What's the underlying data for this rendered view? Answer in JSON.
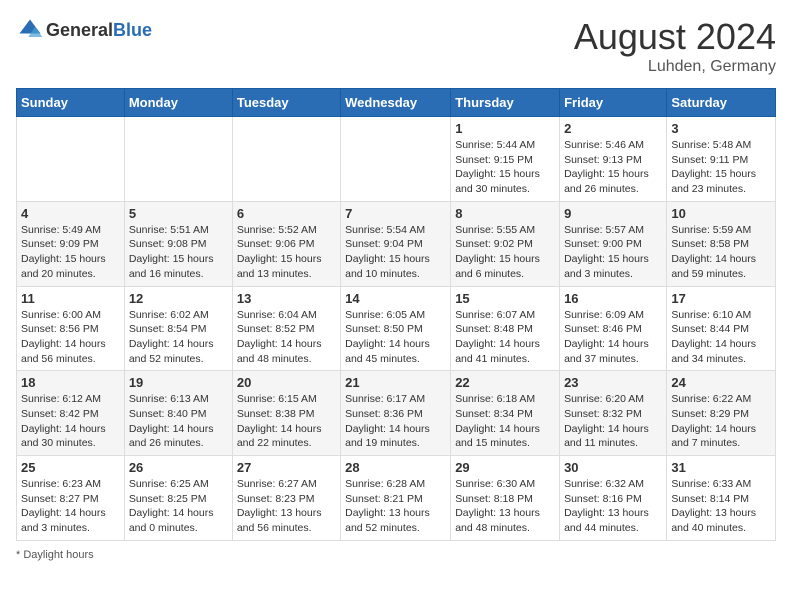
{
  "header": {
    "logo_general": "General",
    "logo_blue": "Blue",
    "month_year": "August 2024",
    "location": "Luhden, Germany"
  },
  "days_of_week": [
    "Sunday",
    "Monday",
    "Tuesday",
    "Wednesday",
    "Thursday",
    "Friday",
    "Saturday"
  ],
  "weeks": [
    [
      {
        "day": "",
        "info": ""
      },
      {
        "day": "",
        "info": ""
      },
      {
        "day": "",
        "info": ""
      },
      {
        "day": "",
        "info": ""
      },
      {
        "day": "1",
        "info": "Sunrise: 5:44 AM\nSunset: 9:15 PM\nDaylight: 15 hours\nand 30 minutes."
      },
      {
        "day": "2",
        "info": "Sunrise: 5:46 AM\nSunset: 9:13 PM\nDaylight: 15 hours\nand 26 minutes."
      },
      {
        "day": "3",
        "info": "Sunrise: 5:48 AM\nSunset: 9:11 PM\nDaylight: 15 hours\nand 23 minutes."
      }
    ],
    [
      {
        "day": "4",
        "info": "Sunrise: 5:49 AM\nSunset: 9:09 PM\nDaylight: 15 hours\nand 20 minutes."
      },
      {
        "day": "5",
        "info": "Sunrise: 5:51 AM\nSunset: 9:08 PM\nDaylight: 15 hours\nand 16 minutes."
      },
      {
        "day": "6",
        "info": "Sunrise: 5:52 AM\nSunset: 9:06 PM\nDaylight: 15 hours\nand 13 minutes."
      },
      {
        "day": "7",
        "info": "Sunrise: 5:54 AM\nSunset: 9:04 PM\nDaylight: 15 hours\nand 10 minutes."
      },
      {
        "day": "8",
        "info": "Sunrise: 5:55 AM\nSunset: 9:02 PM\nDaylight: 15 hours\nand 6 minutes."
      },
      {
        "day": "9",
        "info": "Sunrise: 5:57 AM\nSunset: 9:00 PM\nDaylight: 15 hours\nand 3 minutes."
      },
      {
        "day": "10",
        "info": "Sunrise: 5:59 AM\nSunset: 8:58 PM\nDaylight: 14 hours\nand 59 minutes."
      }
    ],
    [
      {
        "day": "11",
        "info": "Sunrise: 6:00 AM\nSunset: 8:56 PM\nDaylight: 14 hours\nand 56 minutes."
      },
      {
        "day": "12",
        "info": "Sunrise: 6:02 AM\nSunset: 8:54 PM\nDaylight: 14 hours\nand 52 minutes."
      },
      {
        "day": "13",
        "info": "Sunrise: 6:04 AM\nSunset: 8:52 PM\nDaylight: 14 hours\nand 48 minutes."
      },
      {
        "day": "14",
        "info": "Sunrise: 6:05 AM\nSunset: 8:50 PM\nDaylight: 14 hours\nand 45 minutes."
      },
      {
        "day": "15",
        "info": "Sunrise: 6:07 AM\nSunset: 8:48 PM\nDaylight: 14 hours\nand 41 minutes."
      },
      {
        "day": "16",
        "info": "Sunrise: 6:09 AM\nSunset: 8:46 PM\nDaylight: 14 hours\nand 37 minutes."
      },
      {
        "day": "17",
        "info": "Sunrise: 6:10 AM\nSunset: 8:44 PM\nDaylight: 14 hours\nand 34 minutes."
      }
    ],
    [
      {
        "day": "18",
        "info": "Sunrise: 6:12 AM\nSunset: 8:42 PM\nDaylight: 14 hours\nand 30 minutes."
      },
      {
        "day": "19",
        "info": "Sunrise: 6:13 AM\nSunset: 8:40 PM\nDaylight: 14 hours\nand 26 minutes."
      },
      {
        "day": "20",
        "info": "Sunrise: 6:15 AM\nSunset: 8:38 PM\nDaylight: 14 hours\nand 22 minutes."
      },
      {
        "day": "21",
        "info": "Sunrise: 6:17 AM\nSunset: 8:36 PM\nDaylight: 14 hours\nand 19 minutes."
      },
      {
        "day": "22",
        "info": "Sunrise: 6:18 AM\nSunset: 8:34 PM\nDaylight: 14 hours\nand 15 minutes."
      },
      {
        "day": "23",
        "info": "Sunrise: 6:20 AM\nSunset: 8:32 PM\nDaylight: 14 hours\nand 11 minutes."
      },
      {
        "day": "24",
        "info": "Sunrise: 6:22 AM\nSunset: 8:29 PM\nDaylight: 14 hours\nand 7 minutes."
      }
    ],
    [
      {
        "day": "25",
        "info": "Sunrise: 6:23 AM\nSunset: 8:27 PM\nDaylight: 14 hours\nand 3 minutes."
      },
      {
        "day": "26",
        "info": "Sunrise: 6:25 AM\nSunset: 8:25 PM\nDaylight: 14 hours\nand 0 minutes."
      },
      {
        "day": "27",
        "info": "Sunrise: 6:27 AM\nSunset: 8:23 PM\nDaylight: 13 hours\nand 56 minutes."
      },
      {
        "day": "28",
        "info": "Sunrise: 6:28 AM\nSunset: 8:21 PM\nDaylight: 13 hours\nand 52 minutes."
      },
      {
        "day": "29",
        "info": "Sunrise: 6:30 AM\nSunset: 8:18 PM\nDaylight: 13 hours\nand 48 minutes."
      },
      {
        "day": "30",
        "info": "Sunrise: 6:32 AM\nSunset: 8:16 PM\nDaylight: 13 hours\nand 44 minutes."
      },
      {
        "day": "31",
        "info": "Sunrise: 6:33 AM\nSunset: 8:14 PM\nDaylight: 13 hours\nand 40 minutes."
      }
    ]
  ],
  "footer": {
    "daylight_label": "Daylight hours"
  }
}
